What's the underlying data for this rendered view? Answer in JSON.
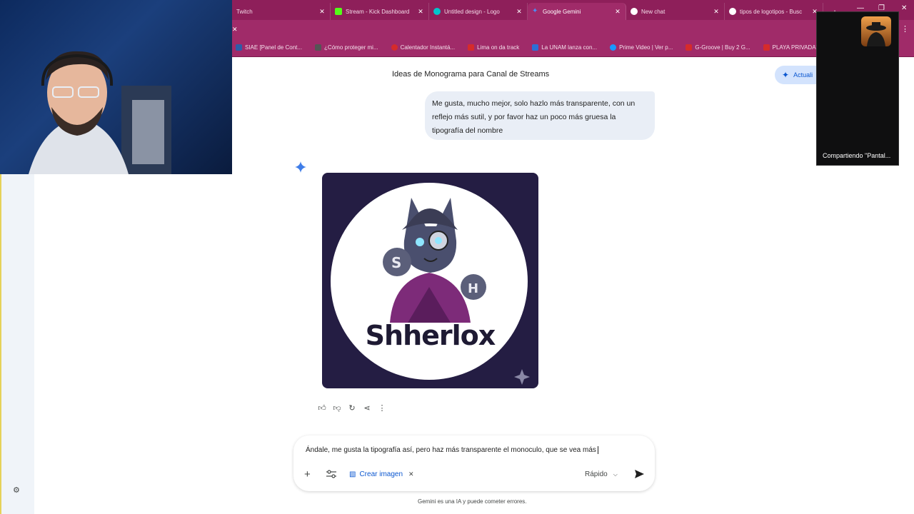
{
  "browser": {
    "tabs": [
      {
        "label": "Twitch",
        "color": "#9146ff",
        "active": false
      },
      {
        "label": "Stream - Kick Dashboard",
        "color": "#53fc18",
        "active": false
      },
      {
        "label": "Untitled design - Logo",
        "color": "#00c4cc",
        "active": false
      },
      {
        "label": "Google Gemini",
        "color": "#4c8df6",
        "active": true
      },
      {
        "label": "New chat",
        "color": "#ffffff",
        "active": false
      },
      {
        "label": "tipos de logotipos - Busc",
        "color": "#ea4335",
        "active": false
      }
    ],
    "bookmarks": [
      {
        "label": "SIAE [Panel de Cont...",
        "color": "#2d5da8"
      },
      {
        "label": "¿Cómo proteger mi...",
        "color": "#555555"
      },
      {
        "label": "Calentador Instantá...",
        "color": "#d62b2b"
      },
      {
        "label": "Lima on da track",
        "color": "#d62b2b"
      },
      {
        "label": "La UNAM lanza con...",
        "color": "#2d6fd6"
      },
      {
        "label": "Prime Video | Ver p...",
        "color": "#1a98ff"
      },
      {
        "label": "G-Groove | Buy 2 G...",
        "color": "#d62b2b"
      },
      {
        "label": "PLAYA PRIVADA\" R...",
        "color": "#d62b2b"
      }
    ]
  },
  "chat": {
    "title": "Ideas de Monograma para Canal de Streams",
    "update_label": "Actuali",
    "user_message": "Me gusta, mucho mejor, solo hazlo más transparente, con un reflejo más sutil, y por favor haz un poco más gruesa la tipografía del nombre",
    "image_brand_text": "Shherlox"
  },
  "input": {
    "value": "Ándale, me gusta la tipografía así, pero haz más transparente el monoculo, que se vea más",
    "crear_imagen": "Crear imagen",
    "model": "Rápido"
  },
  "disclaimer": "Gemini es una IA y puede cometer errores.",
  "share": {
    "label": "Compartiendo \"Pantal..."
  },
  "colors": {
    "chrome": "#a02b69",
    "accent": "#0b57d0",
    "image_bg": "#241d43"
  }
}
